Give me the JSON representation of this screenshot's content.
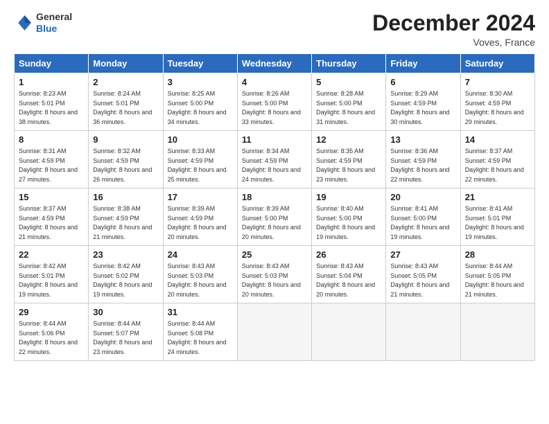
{
  "header": {
    "logo_general": "General",
    "logo_blue": "Blue",
    "month_title": "December 2024",
    "location": "Voves, France"
  },
  "weekdays": [
    "Sunday",
    "Monday",
    "Tuesday",
    "Wednesday",
    "Thursday",
    "Friday",
    "Saturday"
  ],
  "weeks": [
    [
      {
        "day": "1",
        "sunrise": "Sunrise: 8:23 AM",
        "sunset": "Sunset: 5:01 PM",
        "daylight": "Daylight: 8 hours and 38 minutes."
      },
      {
        "day": "2",
        "sunrise": "Sunrise: 8:24 AM",
        "sunset": "Sunset: 5:01 PM",
        "daylight": "Daylight: 8 hours and 36 minutes."
      },
      {
        "day": "3",
        "sunrise": "Sunrise: 8:25 AM",
        "sunset": "Sunset: 5:00 PM",
        "daylight": "Daylight: 8 hours and 34 minutes."
      },
      {
        "day": "4",
        "sunrise": "Sunrise: 8:26 AM",
        "sunset": "Sunset: 5:00 PM",
        "daylight": "Daylight: 8 hours and 33 minutes."
      },
      {
        "day": "5",
        "sunrise": "Sunrise: 8:28 AM",
        "sunset": "Sunset: 5:00 PM",
        "daylight": "Daylight: 8 hours and 31 minutes."
      },
      {
        "day": "6",
        "sunrise": "Sunrise: 8:29 AM",
        "sunset": "Sunset: 4:59 PM",
        "daylight": "Daylight: 8 hours and 30 minutes."
      },
      {
        "day": "7",
        "sunrise": "Sunrise: 8:30 AM",
        "sunset": "Sunset: 4:59 PM",
        "daylight": "Daylight: 8 hours and 29 minutes."
      }
    ],
    [
      {
        "day": "8",
        "sunrise": "Sunrise: 8:31 AM",
        "sunset": "Sunset: 4:59 PM",
        "daylight": "Daylight: 8 hours and 27 minutes."
      },
      {
        "day": "9",
        "sunrise": "Sunrise: 8:32 AM",
        "sunset": "Sunset: 4:59 PM",
        "daylight": "Daylight: 8 hours and 26 minutes."
      },
      {
        "day": "10",
        "sunrise": "Sunrise: 8:33 AM",
        "sunset": "Sunset: 4:59 PM",
        "daylight": "Daylight: 8 hours and 25 minutes."
      },
      {
        "day": "11",
        "sunrise": "Sunrise: 8:34 AM",
        "sunset": "Sunset: 4:59 PM",
        "daylight": "Daylight: 8 hours and 24 minutes."
      },
      {
        "day": "12",
        "sunrise": "Sunrise: 8:35 AM",
        "sunset": "Sunset: 4:59 PM",
        "daylight": "Daylight: 8 hours and 23 minutes."
      },
      {
        "day": "13",
        "sunrise": "Sunrise: 8:36 AM",
        "sunset": "Sunset: 4:59 PM",
        "daylight": "Daylight: 8 hours and 22 minutes."
      },
      {
        "day": "14",
        "sunrise": "Sunrise: 8:37 AM",
        "sunset": "Sunset: 4:59 PM",
        "daylight": "Daylight: 8 hours and 22 minutes."
      }
    ],
    [
      {
        "day": "15",
        "sunrise": "Sunrise: 8:37 AM",
        "sunset": "Sunset: 4:59 PM",
        "daylight": "Daylight: 8 hours and 21 minutes."
      },
      {
        "day": "16",
        "sunrise": "Sunrise: 8:38 AM",
        "sunset": "Sunset: 4:59 PM",
        "daylight": "Daylight: 8 hours and 21 minutes."
      },
      {
        "day": "17",
        "sunrise": "Sunrise: 8:39 AM",
        "sunset": "Sunset: 4:59 PM",
        "daylight": "Daylight: 8 hours and 20 minutes."
      },
      {
        "day": "18",
        "sunrise": "Sunrise: 8:39 AM",
        "sunset": "Sunset: 5:00 PM",
        "daylight": "Daylight: 8 hours and 20 minutes."
      },
      {
        "day": "19",
        "sunrise": "Sunrise: 8:40 AM",
        "sunset": "Sunset: 5:00 PM",
        "daylight": "Daylight: 8 hours and 19 minutes."
      },
      {
        "day": "20",
        "sunrise": "Sunrise: 8:41 AM",
        "sunset": "Sunset: 5:00 PM",
        "daylight": "Daylight: 8 hours and 19 minutes."
      },
      {
        "day": "21",
        "sunrise": "Sunrise: 8:41 AM",
        "sunset": "Sunset: 5:01 PM",
        "daylight": "Daylight: 8 hours and 19 minutes."
      }
    ],
    [
      {
        "day": "22",
        "sunrise": "Sunrise: 8:42 AM",
        "sunset": "Sunset: 5:01 PM",
        "daylight": "Daylight: 8 hours and 19 minutes."
      },
      {
        "day": "23",
        "sunrise": "Sunrise: 8:42 AM",
        "sunset": "Sunset: 5:02 PM",
        "daylight": "Daylight: 8 hours and 19 minutes."
      },
      {
        "day": "24",
        "sunrise": "Sunrise: 8:43 AM",
        "sunset": "Sunset: 5:03 PM",
        "daylight": "Daylight: 8 hours and 20 minutes."
      },
      {
        "day": "25",
        "sunrise": "Sunrise: 8:43 AM",
        "sunset": "Sunset: 5:03 PM",
        "daylight": "Daylight: 8 hours and 20 minutes."
      },
      {
        "day": "26",
        "sunrise": "Sunrise: 8:43 AM",
        "sunset": "Sunset: 5:04 PM",
        "daylight": "Daylight: 8 hours and 20 minutes."
      },
      {
        "day": "27",
        "sunrise": "Sunrise: 8:43 AM",
        "sunset": "Sunset: 5:05 PM",
        "daylight": "Daylight: 8 hours and 21 minutes."
      },
      {
        "day": "28",
        "sunrise": "Sunrise: 8:44 AM",
        "sunset": "Sunset: 5:05 PM",
        "daylight": "Daylight: 8 hours and 21 minutes."
      }
    ],
    [
      {
        "day": "29",
        "sunrise": "Sunrise: 8:44 AM",
        "sunset": "Sunset: 5:06 PM",
        "daylight": "Daylight: 8 hours and 22 minutes."
      },
      {
        "day": "30",
        "sunrise": "Sunrise: 8:44 AM",
        "sunset": "Sunset: 5:07 PM",
        "daylight": "Daylight: 8 hours and 23 minutes."
      },
      {
        "day": "31",
        "sunrise": "Sunrise: 8:44 AM",
        "sunset": "Sunset: 5:08 PM",
        "daylight": "Daylight: 8 hours and 24 minutes."
      },
      null,
      null,
      null,
      null
    ]
  ]
}
